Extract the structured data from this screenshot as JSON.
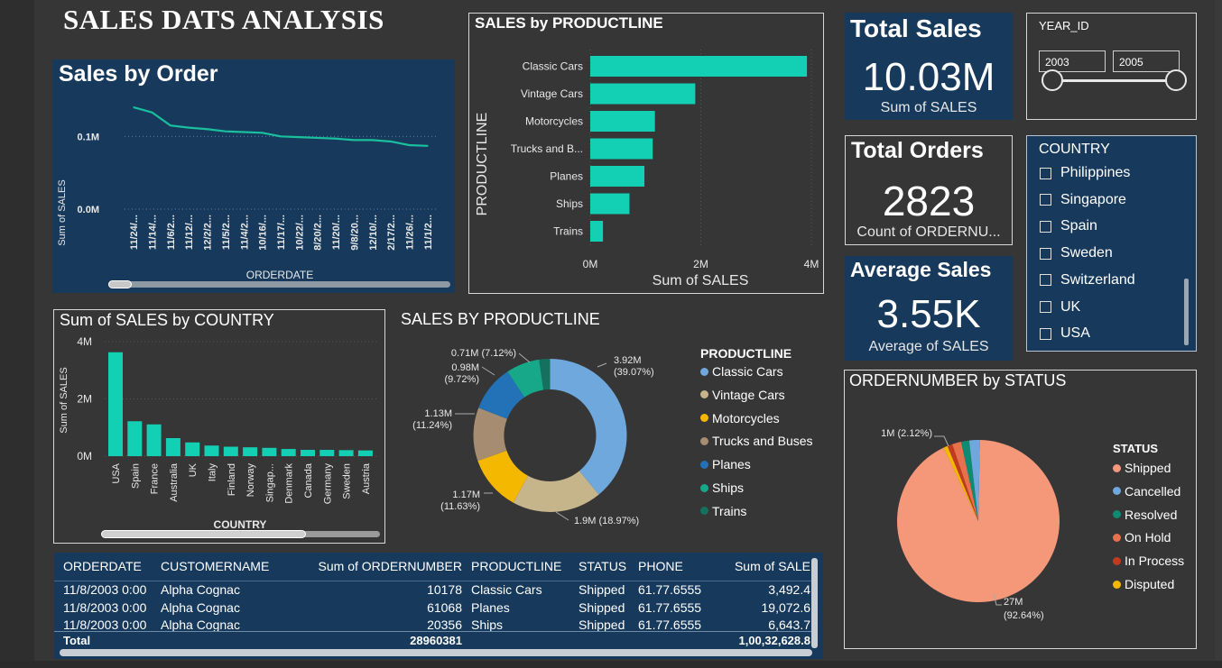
{
  "title": "SALES DATS ANALYSIS",
  "colors": {
    "bar": "#13cfb4",
    "blue_panel": "#173a5c",
    "background": "#363636"
  },
  "sales_by_order": {
    "title": "Sales by Order",
    "xlabel": "ORDERDATE",
    "ylabel": "Sum of SALES",
    "yticks": [
      "0.1M",
      "0.0M"
    ],
    "xticks": [
      "11/24/...",
      "11/14/...",
      "11/6/2...",
      "11/12/...",
      "12/2/2...",
      "11/5/2...",
      "11/4/2...",
      "10/16/...",
      "11/17/...",
      "10/22/...",
      "8/20/2...",
      "11/20/...",
      "9/8/20...",
      "12/10/...",
      "2/17/2...",
      "11/26/...",
      "11/1/2..."
    ]
  },
  "productline_bar": {
    "title": "SALES by PRODUCTLINE",
    "ylabel": "PRODUCTLINE",
    "xlabel": "Sum of SALES",
    "xticks": [
      "0M",
      "2M",
      "4M"
    ],
    "categories": [
      "Classic Cars",
      "Vintage Cars",
      "Motorcycles",
      "Trucks and B...",
      "Planes",
      "Ships",
      "Trains"
    ]
  },
  "kpis": {
    "total_sales": {
      "title": "Total Sales",
      "value": "10.03M",
      "sub": "Sum of SALES"
    },
    "total_orders": {
      "title": "Total Orders",
      "value": "2823",
      "sub": "Count of ORDERNU..."
    },
    "average_sales": {
      "title": "Average Sales",
      "value": "3.55K",
      "sub": "Average of SALES"
    }
  },
  "year_slicer": {
    "label": "YEAR_ID",
    "from": "2003",
    "to": "2005"
  },
  "country_slicer": {
    "title": "COUNTRY",
    "items": [
      "Philippines",
      "Singapore",
      "Spain",
      "Sweden",
      "Switzerland",
      "UK",
      "USA"
    ]
  },
  "country_chart": {
    "title": "Sum of SALES by COUNTRY",
    "xlabel": "COUNTRY",
    "ylabel": "Sum of SALES",
    "yticks": [
      "4M",
      "2M",
      "0M"
    ],
    "categories": [
      "USA",
      "Spain",
      "France",
      "Australia",
      "UK",
      "Italy",
      "Finland",
      "Norway",
      "Singap...",
      "Denmark",
      "Canada",
      "Germany",
      "Sweden",
      "Austria"
    ]
  },
  "donut": {
    "title": "SALES BY PRODUCTLINE",
    "legend_title": "PRODUCTLINE",
    "labels": [
      {
        "line1": "3.92M",
        "line2": "(39.07%)"
      },
      {
        "line1": "1.9M (18.97%)",
        "line2": ""
      },
      {
        "line1": "1.17M",
        "line2": "(11.63%)"
      },
      {
        "line1": "1.13M",
        "line2": "(11.24%)"
      },
      {
        "line1": "0.98M",
        "line2": "(9.72%)"
      },
      {
        "line1": "0.71M (7.12%)",
        "line2": ""
      }
    ],
    "legend": [
      "Classic Cars",
      "Vintage Cars",
      "Motorcycles",
      "Trucks and Buses",
      "Planes",
      "Ships",
      "Trains"
    ]
  },
  "status_pie": {
    "title": "ORDERNUMBER by STATUS",
    "legend_title": "STATUS",
    "label_small": "1M (2.12%)",
    "label_big_1": "27M",
    "label_big_2": "(92.64%)",
    "legend": [
      "Shipped",
      "Cancelled",
      "Resolved",
      "On Hold",
      "In Process",
      "Disputed"
    ]
  },
  "table": {
    "headers": [
      "ORDERDATE",
      "CUSTOMERNAME",
      "Sum of ORDERNUMBER",
      "PRODUCTLINE",
      "STATUS",
      "PHONE",
      "Sum of SALE"
    ],
    "rows": [
      [
        "11/8/2003 0:00",
        "Alpha Cognac",
        "10178",
        "Classic Cars",
        "Shipped",
        "61.77.6555",
        "3,492.4"
      ],
      [
        "11/8/2003 0:00",
        "Alpha Cognac",
        "61068",
        "Planes",
        "Shipped",
        "61.77.6555",
        "19,072.6"
      ],
      [
        "11/8/2003 0:00",
        "Alpha Cognac",
        "20356",
        "Ships",
        "Shipped",
        "61.77.6555",
        "6,643.7"
      ]
    ],
    "total": [
      "Total",
      "28960381",
      "1,00,32,628.8"
    ]
  },
  "chart_data": [
    {
      "type": "line",
      "title": "Sales by Order",
      "xlabel": "ORDERDATE",
      "ylabel": "Sum of SALES",
      "x": [
        "11/24/...",
        "11/14/...",
        "11/6/2...",
        "11/12/...",
        "12/2/2...",
        "11/5/2...",
        "11/4/2...",
        "10/16/...",
        "11/17/...",
        "10/22/...",
        "8/20/2...",
        "11/20/...",
        "9/8/20...",
        "12/10/...",
        "2/17/2...",
        "11/26/...",
        "11/1/2..."
      ],
      "values": [
        0.14,
        0.133,
        0.115,
        0.112,
        0.11,
        0.107,
        0.106,
        0.105,
        0.1,
        0.099,
        0.098,
        0.097,
        0.095,
        0.095,
        0.093,
        0.088,
        0.087
      ],
      "ylim": [
        0,
        0.15
      ],
      "grid": true
    },
    {
      "type": "bar",
      "orientation": "horizontal",
      "title": "SALES by PRODUCTLINE",
      "xlabel": "Sum of SALES",
      "ylabel": "PRODUCTLINE",
      "categories": [
        "Classic Cars",
        "Vintage Cars",
        "Motorcycles",
        "Trucks and B...",
        "Planes",
        "Ships",
        "Trains"
      ],
      "values": [
        3.92,
        1.9,
        1.17,
        1.13,
        0.98,
        0.71,
        0.23
      ],
      "xlim": [
        0,
        4.2
      ]
    },
    {
      "type": "bar",
      "title": "Sum of SALES by COUNTRY",
      "xlabel": "COUNTRY",
      "ylabel": "Sum of SALES",
      "categories": [
        "USA",
        "Spain",
        "France",
        "Australia",
        "UK",
        "Italy",
        "Finland",
        "Norway",
        "Singap...",
        "Denmark",
        "Canada",
        "Germany",
        "Sweden",
        "Austria"
      ],
      "values": [
        3.63,
        1.22,
        1.11,
        0.63,
        0.48,
        0.37,
        0.33,
        0.31,
        0.29,
        0.25,
        0.22,
        0.22,
        0.21,
        0.2
      ],
      "ylim": [
        0,
        4
      ]
    },
    {
      "type": "pie",
      "title": "SALES BY PRODUCTLINE",
      "categories": [
        "Classic Cars",
        "Vintage Cars",
        "Motorcycles",
        "Trucks and Buses",
        "Planes",
        "Ships",
        "Trains"
      ],
      "values": [
        3.92,
        1.9,
        1.17,
        1.13,
        0.98,
        0.71,
        0.23
      ],
      "colors": [
        "#6fa8dc",
        "#c6b58b",
        "#f5b800",
        "#a68c70",
        "#2372b8",
        "#17a889",
        "#14705f"
      ],
      "donut": true,
      "legend": "right"
    },
    {
      "type": "pie",
      "title": "ORDERNUMBER by STATUS",
      "categories": [
        "Shipped",
        "Cancelled",
        "Resolved",
        "On Hold",
        "In Process",
        "Disputed"
      ],
      "values": [
        92.64,
        2.12,
        1.6,
        1.8,
        1.0,
        0.84
      ],
      "colors": [
        "#f5987a",
        "#6fa8dc",
        "#0f8a73",
        "#e8704d",
        "#c23b1e",
        "#f5b800"
      ],
      "legend": "right"
    }
  ]
}
